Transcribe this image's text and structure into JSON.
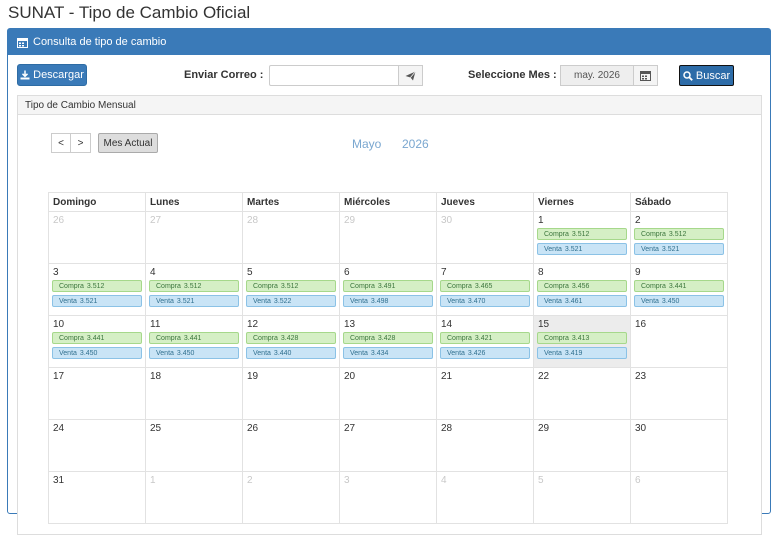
{
  "page_title": "SUNAT - Tipo de Cambio Oficial",
  "panel": {
    "heading": "Consulta de tipo de cambio"
  },
  "toolbar": {
    "download_label": "Descargar",
    "email_label": "Enviar Correo :",
    "email_value": "",
    "month_label": "Seleccione Mes :",
    "month_value": "may. 2026",
    "search_label": "Buscar"
  },
  "calendar": {
    "section_title": "Tipo de Cambio Mensual",
    "prev_label": "<",
    "next_label": ">",
    "current_month_label": "Mes Actual",
    "month_name": "Mayo",
    "year": "2026",
    "weekdays": [
      "Domingo",
      "Lunes",
      "Martes",
      "Miércoles",
      "Jueves",
      "Viernes",
      "Sábado"
    ],
    "buy_label": "Compra",
    "sell_label": "Venta",
    "weeks": [
      [
        {
          "day": "26",
          "other": true
        },
        {
          "day": "27",
          "other": true
        },
        {
          "day": "28",
          "other": true
        },
        {
          "day": "29",
          "other": true
        },
        {
          "day": "30",
          "other": true
        },
        {
          "day": "1",
          "compra": "3.512",
          "venta": "3.521"
        },
        {
          "day": "2",
          "compra": "3.512",
          "venta": "3.521"
        }
      ],
      [
        {
          "day": "3",
          "compra": "3.512",
          "venta": "3.521"
        },
        {
          "day": "4",
          "compra": "3.512",
          "venta": "3.521"
        },
        {
          "day": "5",
          "compra": "3.512",
          "venta": "3.522"
        },
        {
          "day": "6",
          "compra": "3.491",
          "venta": "3.498"
        },
        {
          "day": "7",
          "compra": "3.465",
          "venta": "3.470"
        },
        {
          "day": "8",
          "compra": "3.456",
          "venta": "3.461"
        },
        {
          "day": "9",
          "compra": "3.441",
          "venta": "3.450"
        }
      ],
      [
        {
          "day": "10",
          "compra": "3.441",
          "venta": "3.450"
        },
        {
          "day": "11",
          "compra": "3.441",
          "venta": "3.450"
        },
        {
          "day": "12",
          "compra": "3.428",
          "venta": "3.440"
        },
        {
          "day": "13",
          "compra": "3.428",
          "venta": "3.434"
        },
        {
          "day": "14",
          "compra": "3.421",
          "venta": "3.426"
        },
        {
          "day": "15",
          "compra": "3.413",
          "venta": "3.419",
          "today": true
        },
        {
          "day": "16"
        }
      ],
      [
        {
          "day": "17"
        },
        {
          "day": "18"
        },
        {
          "day": "19"
        },
        {
          "day": "20"
        },
        {
          "day": "21"
        },
        {
          "day": "22"
        },
        {
          "day": "23"
        }
      ],
      [
        {
          "day": "24"
        },
        {
          "day": "25"
        },
        {
          "day": "26"
        },
        {
          "day": "27"
        },
        {
          "day": "28"
        },
        {
          "day": "29"
        },
        {
          "day": "30"
        }
      ],
      [
        {
          "day": "31"
        },
        {
          "day": "1",
          "other": true
        },
        {
          "day": "2",
          "other": true
        },
        {
          "day": "3",
          "other": true
        },
        {
          "day": "4",
          "other": true
        },
        {
          "day": "5",
          "other": true
        },
        {
          "day": "6",
          "other": true
        }
      ]
    ]
  }
}
